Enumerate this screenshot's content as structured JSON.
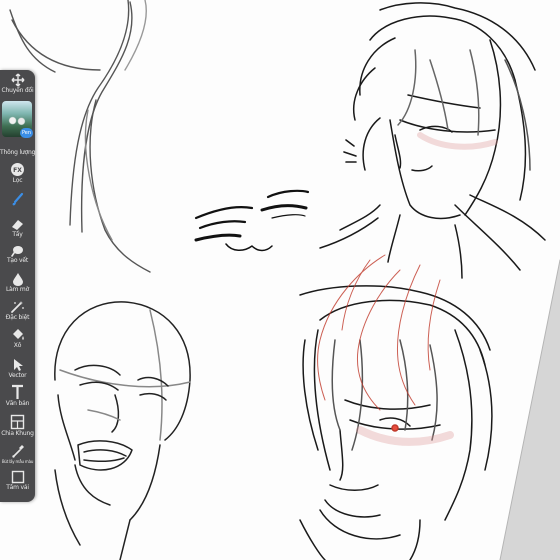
{
  "app": {
    "accent_color": "#3b8ee6",
    "toolbar_color": "#4a4a4c"
  },
  "toolbar": {
    "tools": [
      {
        "id": "transform",
        "label": "Chuyển đổi",
        "icon": "move-arrows-icon"
      },
      {
        "id": "layer",
        "label": "Thông lượng",
        "icon": "layer-thumbnail",
        "badge": "Pen"
      },
      {
        "id": "fx",
        "label": "Lọc",
        "icon": "fx-icon"
      },
      {
        "id": "brush",
        "label": "",
        "icon": "brush-icon",
        "active": true
      },
      {
        "id": "eraser",
        "label": "Tẩy",
        "icon": "eraser-icon"
      },
      {
        "id": "smudge",
        "label": "Tạo vết",
        "icon": "smudge-icon"
      },
      {
        "id": "blur",
        "label": "Làm mờ",
        "icon": "water-drop-icon"
      },
      {
        "id": "special",
        "label": "Đặc biệt",
        "icon": "magic-wand-icon"
      },
      {
        "id": "fill",
        "label": "Xô",
        "icon": "paint-bucket-icon"
      },
      {
        "id": "vector",
        "label": "Vector",
        "icon": "cursor-arrow-icon"
      },
      {
        "id": "text",
        "label": "Văn bản",
        "icon": "text-t-icon"
      },
      {
        "id": "frame",
        "label": "Chia Khung",
        "icon": "frame-divider-icon"
      },
      {
        "id": "eyedropper",
        "label": "Bút lấy mẫu màu",
        "icon": "eyedropper-icon"
      },
      {
        "id": "canvas",
        "label": "Tấm vải",
        "icon": "canvas-square-icon"
      }
    ]
  }
}
